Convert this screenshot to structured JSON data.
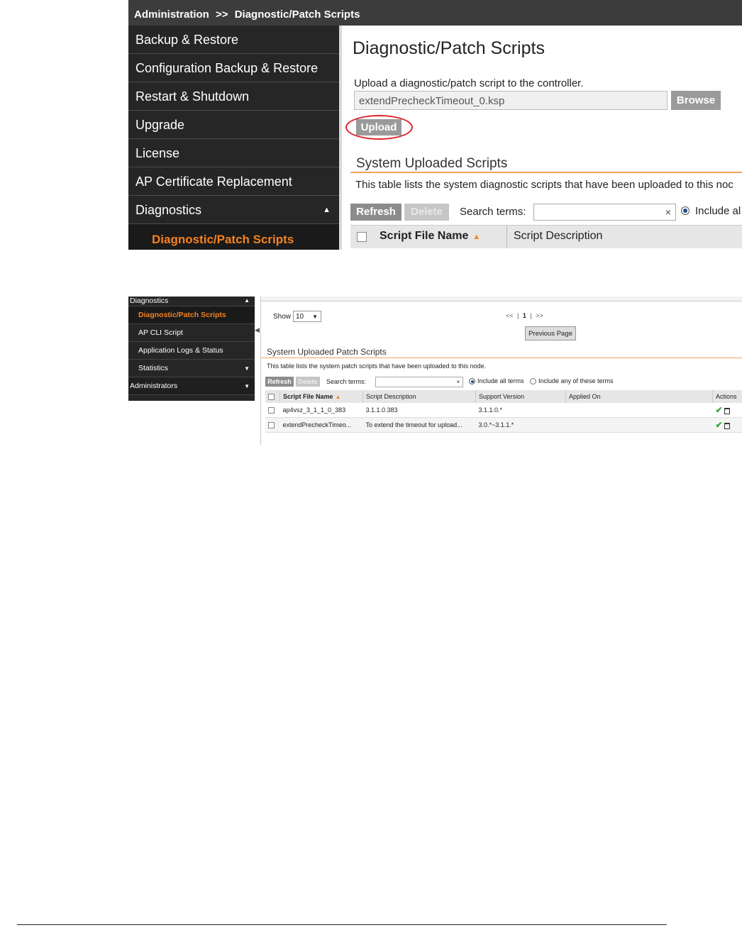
{
  "screenshot1": {
    "breadcrumb": {
      "section": "Administration",
      "separator": ">>",
      "page": "Diagnostic/Patch Scripts"
    },
    "sidebar": {
      "items": [
        {
          "label": "Backup & Restore"
        },
        {
          "label": "Configuration Backup & Restore"
        },
        {
          "label": "Restart & Shutdown"
        },
        {
          "label": "Upgrade"
        },
        {
          "label": "License"
        },
        {
          "label": "AP Certificate Replacement"
        },
        {
          "label": "Diagnostics",
          "expanded": true
        }
      ],
      "subitem": "Diagnostic/Patch Scripts",
      "expand_glyph": "▲"
    },
    "main": {
      "title": "Diagnostic/Patch Scripts",
      "upload_label": "Upload a diagnostic/patch script to the controller.",
      "file_value": "extendPrecheckTimeout_0.ksp",
      "browse_label": "Browse",
      "upload_button": "Upload",
      "section_title": "System Uploaded Scripts",
      "section_desc": "This table lists the system diagnostic scripts that have been uploaded to this noc",
      "refresh_label": "Refresh",
      "delete_label": "Delete",
      "search_label": "Search terms:",
      "search_value": "",
      "clear_glyph": "×",
      "include_label": "Include al",
      "col_name": "Script File Name",
      "col_desc": "Script Description",
      "sort_glyph": "▲"
    }
  },
  "screenshot2": {
    "sidebar": {
      "top": "Diagnostics",
      "items": [
        {
          "label": "Diagnostic/Patch Scripts",
          "active": true
        },
        {
          "label": "AP CLI Script"
        },
        {
          "label": "Application Logs & Status"
        },
        {
          "label": "Statistics"
        }
      ],
      "admin": "Administrators",
      "up_glyph": "▲",
      "down_glyph": "▼",
      "collapse_glyph": "◀"
    },
    "pager": {
      "show_label": "Show",
      "show_value": "10",
      "first": "<<",
      "page": "1",
      "last": ">>",
      "sep": "|",
      "prev_button": "Previous Page"
    },
    "section_title": "System Uploaded Patch Scripts",
    "section_desc": "This table lists the system patch scripts that have been uploaded to this node.",
    "toolbar": {
      "refresh": "Refresh",
      "delete": "Delete",
      "search_label": "Search terms:",
      "clear": "×",
      "include_all": "Include all terms",
      "include_any": "Include any of these terms"
    },
    "table": {
      "headers": [
        "Script File Name",
        "Script Description",
        "Support Version",
        "Applied On",
        "Actions"
      ],
      "rows": [
        {
          "name": "ap4vsz_3_1_1_0_383",
          "desc": "3.1.1.0.383",
          "version": "3.1.1.0.*",
          "applied": ""
        },
        {
          "name": "extendPrecheckTimeo...",
          "desc": "To extend the timeout for upload...",
          "version": "3.0.*~3.1.1.*",
          "applied": ""
        }
      ],
      "apply_glyph": "✔",
      "sort_glyph": "▲"
    }
  }
}
